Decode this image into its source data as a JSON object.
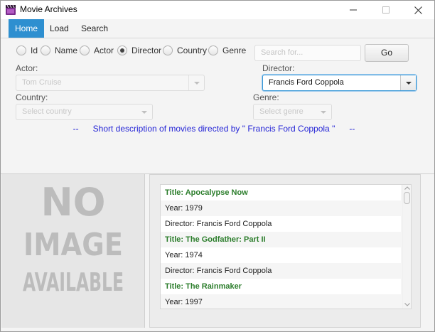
{
  "window": {
    "title": "Movie Archives",
    "icon": "clapperboard-icon"
  },
  "menu": {
    "items": [
      {
        "label": "Home",
        "active": true
      },
      {
        "label": "Load",
        "active": false
      },
      {
        "label": "Search",
        "active": false
      }
    ]
  },
  "search": {
    "radios": [
      {
        "label": "Id",
        "checked": false
      },
      {
        "label": "Name",
        "checked": false
      },
      {
        "label": "Actor",
        "checked": false
      },
      {
        "label": "Director",
        "checked": true
      },
      {
        "label": "Country",
        "checked": false
      },
      {
        "label": "Genre",
        "checked": false
      }
    ],
    "placeholder": "Search for...",
    "go_label": "Go"
  },
  "filters": {
    "actor_label": "Actor:",
    "actor_value": "Tom Cruise",
    "director_label": "Director:",
    "director_value": "Francis Ford Coppola",
    "country_label": "Country:",
    "country_placeholder": "Select country",
    "genre_label": "Genre:",
    "genre_placeholder": "Select genre"
  },
  "description": "--      Short description of movies directed by \" Francis Ford Coppola \"      --",
  "image_panel": {
    "lines": [
      "NO",
      "IMAGE",
      "AVAILABLE"
    ]
  },
  "results": [
    {
      "text": "Title: Apocalypse Now",
      "kind": "title"
    },
    {
      "text": "Year: 1979",
      "kind": "detail"
    },
    {
      "text": "Director: Francis Ford Coppola",
      "kind": "detail"
    },
    {
      "text": "Title: The Godfather: Part II",
      "kind": "title"
    },
    {
      "text": "Year: 1974",
      "kind": "detail"
    },
    {
      "text": "Director: Francis Ford Coppola",
      "kind": "detail"
    },
    {
      "text": "Title: The Rainmaker",
      "kind": "title"
    },
    {
      "text": "Year: 1997",
      "kind": "detail"
    }
  ],
  "colors": {
    "accent": "#2e8fd0",
    "title_green": "#2b7d2b",
    "description_blue": "#2424d6"
  }
}
